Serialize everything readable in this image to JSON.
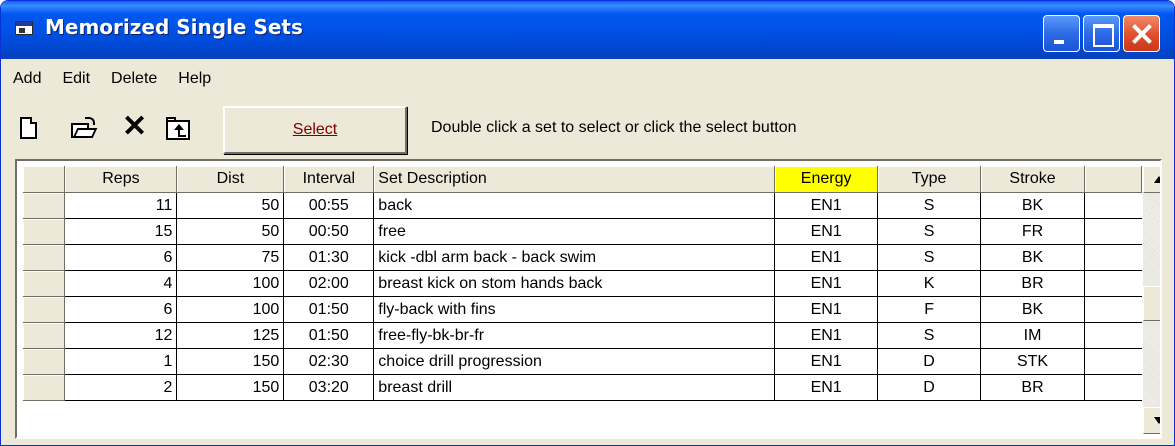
{
  "window": {
    "title": "Memorized Single Sets"
  },
  "menu": [
    "Add",
    "Edit",
    "Delete",
    "Help"
  ],
  "toolbar": {
    "icons": [
      "new-icon",
      "open-icon",
      "delete-icon",
      "up-folder-icon"
    ],
    "select_label": "Select",
    "hint": "Double click a set to select or click the select button"
  },
  "table": {
    "columns": [
      "Reps",
      "Dist",
      "Interval",
      "Set Description",
      "Energy",
      "Type",
      "Stroke"
    ],
    "highlighted_column": "Energy",
    "highlight_color": "#ffff00",
    "rows": [
      {
        "reps": "11",
        "dist": "50",
        "interval": "00:55",
        "description": "back",
        "energy": "EN1",
        "type": "S",
        "stroke": "BK"
      },
      {
        "reps": "15",
        "dist": "50",
        "interval": "00:50",
        "description": "free",
        "energy": "EN1",
        "type": "S",
        "stroke": "FR"
      },
      {
        "reps": "6",
        "dist": "75",
        "interval": "01:30",
        "description": "kick -dbl arm back - back swim",
        "energy": "EN1",
        "type": "S",
        "stroke": "BK"
      },
      {
        "reps": "4",
        "dist": "100",
        "interval": "02:00",
        "description": "breast kick on stom hands back",
        "energy": "EN1",
        "type": "K",
        "stroke": "BR"
      },
      {
        "reps": "6",
        "dist": "100",
        "interval": "01:50",
        "description": "fly-back with fins",
        "energy": "EN1",
        "type": "F",
        "stroke": "BK"
      },
      {
        "reps": "12",
        "dist": "125",
        "interval": "01:50",
        "description": "free-fly-bk-br-fr",
        "energy": "EN1",
        "type": "S",
        "stroke": "IM"
      },
      {
        "reps": "1",
        "dist": "150",
        "interval": "02:30",
        "description": "choice drill progression",
        "energy": "EN1",
        "type": "D",
        "stroke": "STK"
      },
      {
        "reps": "2",
        "dist": "150",
        "interval": "03:20",
        "description": "breast drill",
        "energy": "EN1",
        "type": "D",
        "stroke": "BR"
      }
    ]
  },
  "colors": {
    "titlebar": "#0052e6",
    "window_bg": "#ece9d8",
    "select_text": "#800000"
  }
}
